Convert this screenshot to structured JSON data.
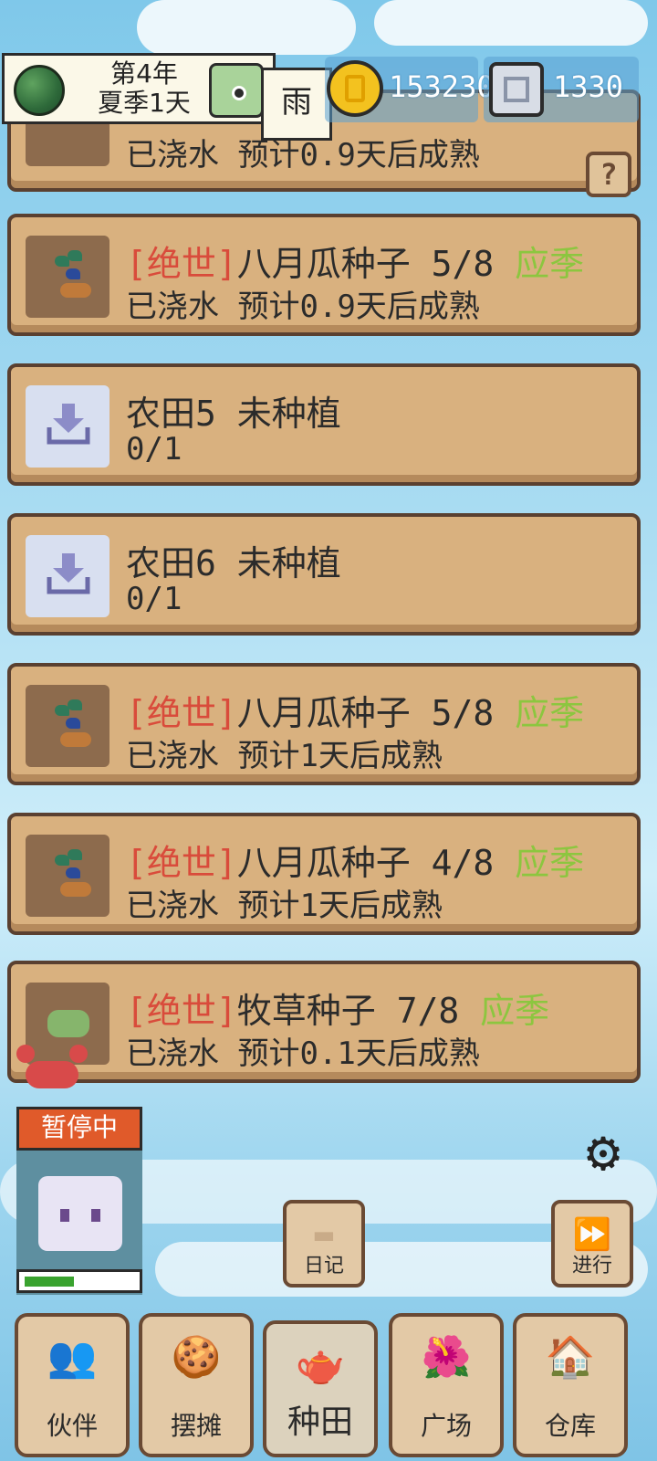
{
  "status": {
    "year": "第4年",
    "season_day": "夏季1天",
    "weather": "雨",
    "gold": "153230",
    "gems": "1330"
  },
  "top_partial": {
    "line": "已浇水 预计0.9天后成熟"
  },
  "plots": [
    {
      "rarity": "[绝世]",
      "name": "八月瓜种子 5/8",
      "season": "应季",
      "status": "已浇水 预计0.9天后成熟",
      "icon": "sprout-icon"
    },
    {
      "rarity": "",
      "name": "农田5 未种植",
      "season": "",
      "status": "0/1",
      "icon": "download-icon"
    },
    {
      "rarity": "",
      "name": "农田6 未种植",
      "season": "",
      "status": "0/1",
      "icon": "download-icon"
    },
    {
      "rarity": "[绝世]",
      "name": "八月瓜种子 5/8",
      "season": "应季",
      "status": "已浇水 预计1天后成熟",
      "icon": "sprout-icon"
    },
    {
      "rarity": "[绝世]",
      "name": "八月瓜种子 4/8",
      "season": "应季",
      "status": "已浇水 预计1天后成熟",
      "icon": "sprout-icon"
    },
    {
      "rarity": "[绝世]",
      "name": "牧草种子 7/8",
      "season": "应季",
      "status": "已浇水 预计0.1天后成熟",
      "icon": "grass-icon"
    }
  ],
  "worker": {
    "state": "暂停中",
    "progress_fraction": 0.45
  },
  "actions": {
    "diary": "日记",
    "proceed": "进行"
  },
  "nav": [
    {
      "label": "伙伴",
      "icon": "partner-icon"
    },
    {
      "label": "摆摊",
      "icon": "stall-icon"
    },
    {
      "label": "种田",
      "icon": "watering-can-icon",
      "active": true
    },
    {
      "label": "广场",
      "icon": "flower-icon"
    },
    {
      "label": "仓库",
      "icon": "house-icon"
    }
  ],
  "colors": {
    "rarity": "#d94b3b",
    "season": "#8cc63f",
    "card": "#d9b17f",
    "pause": "#e05a2a"
  }
}
